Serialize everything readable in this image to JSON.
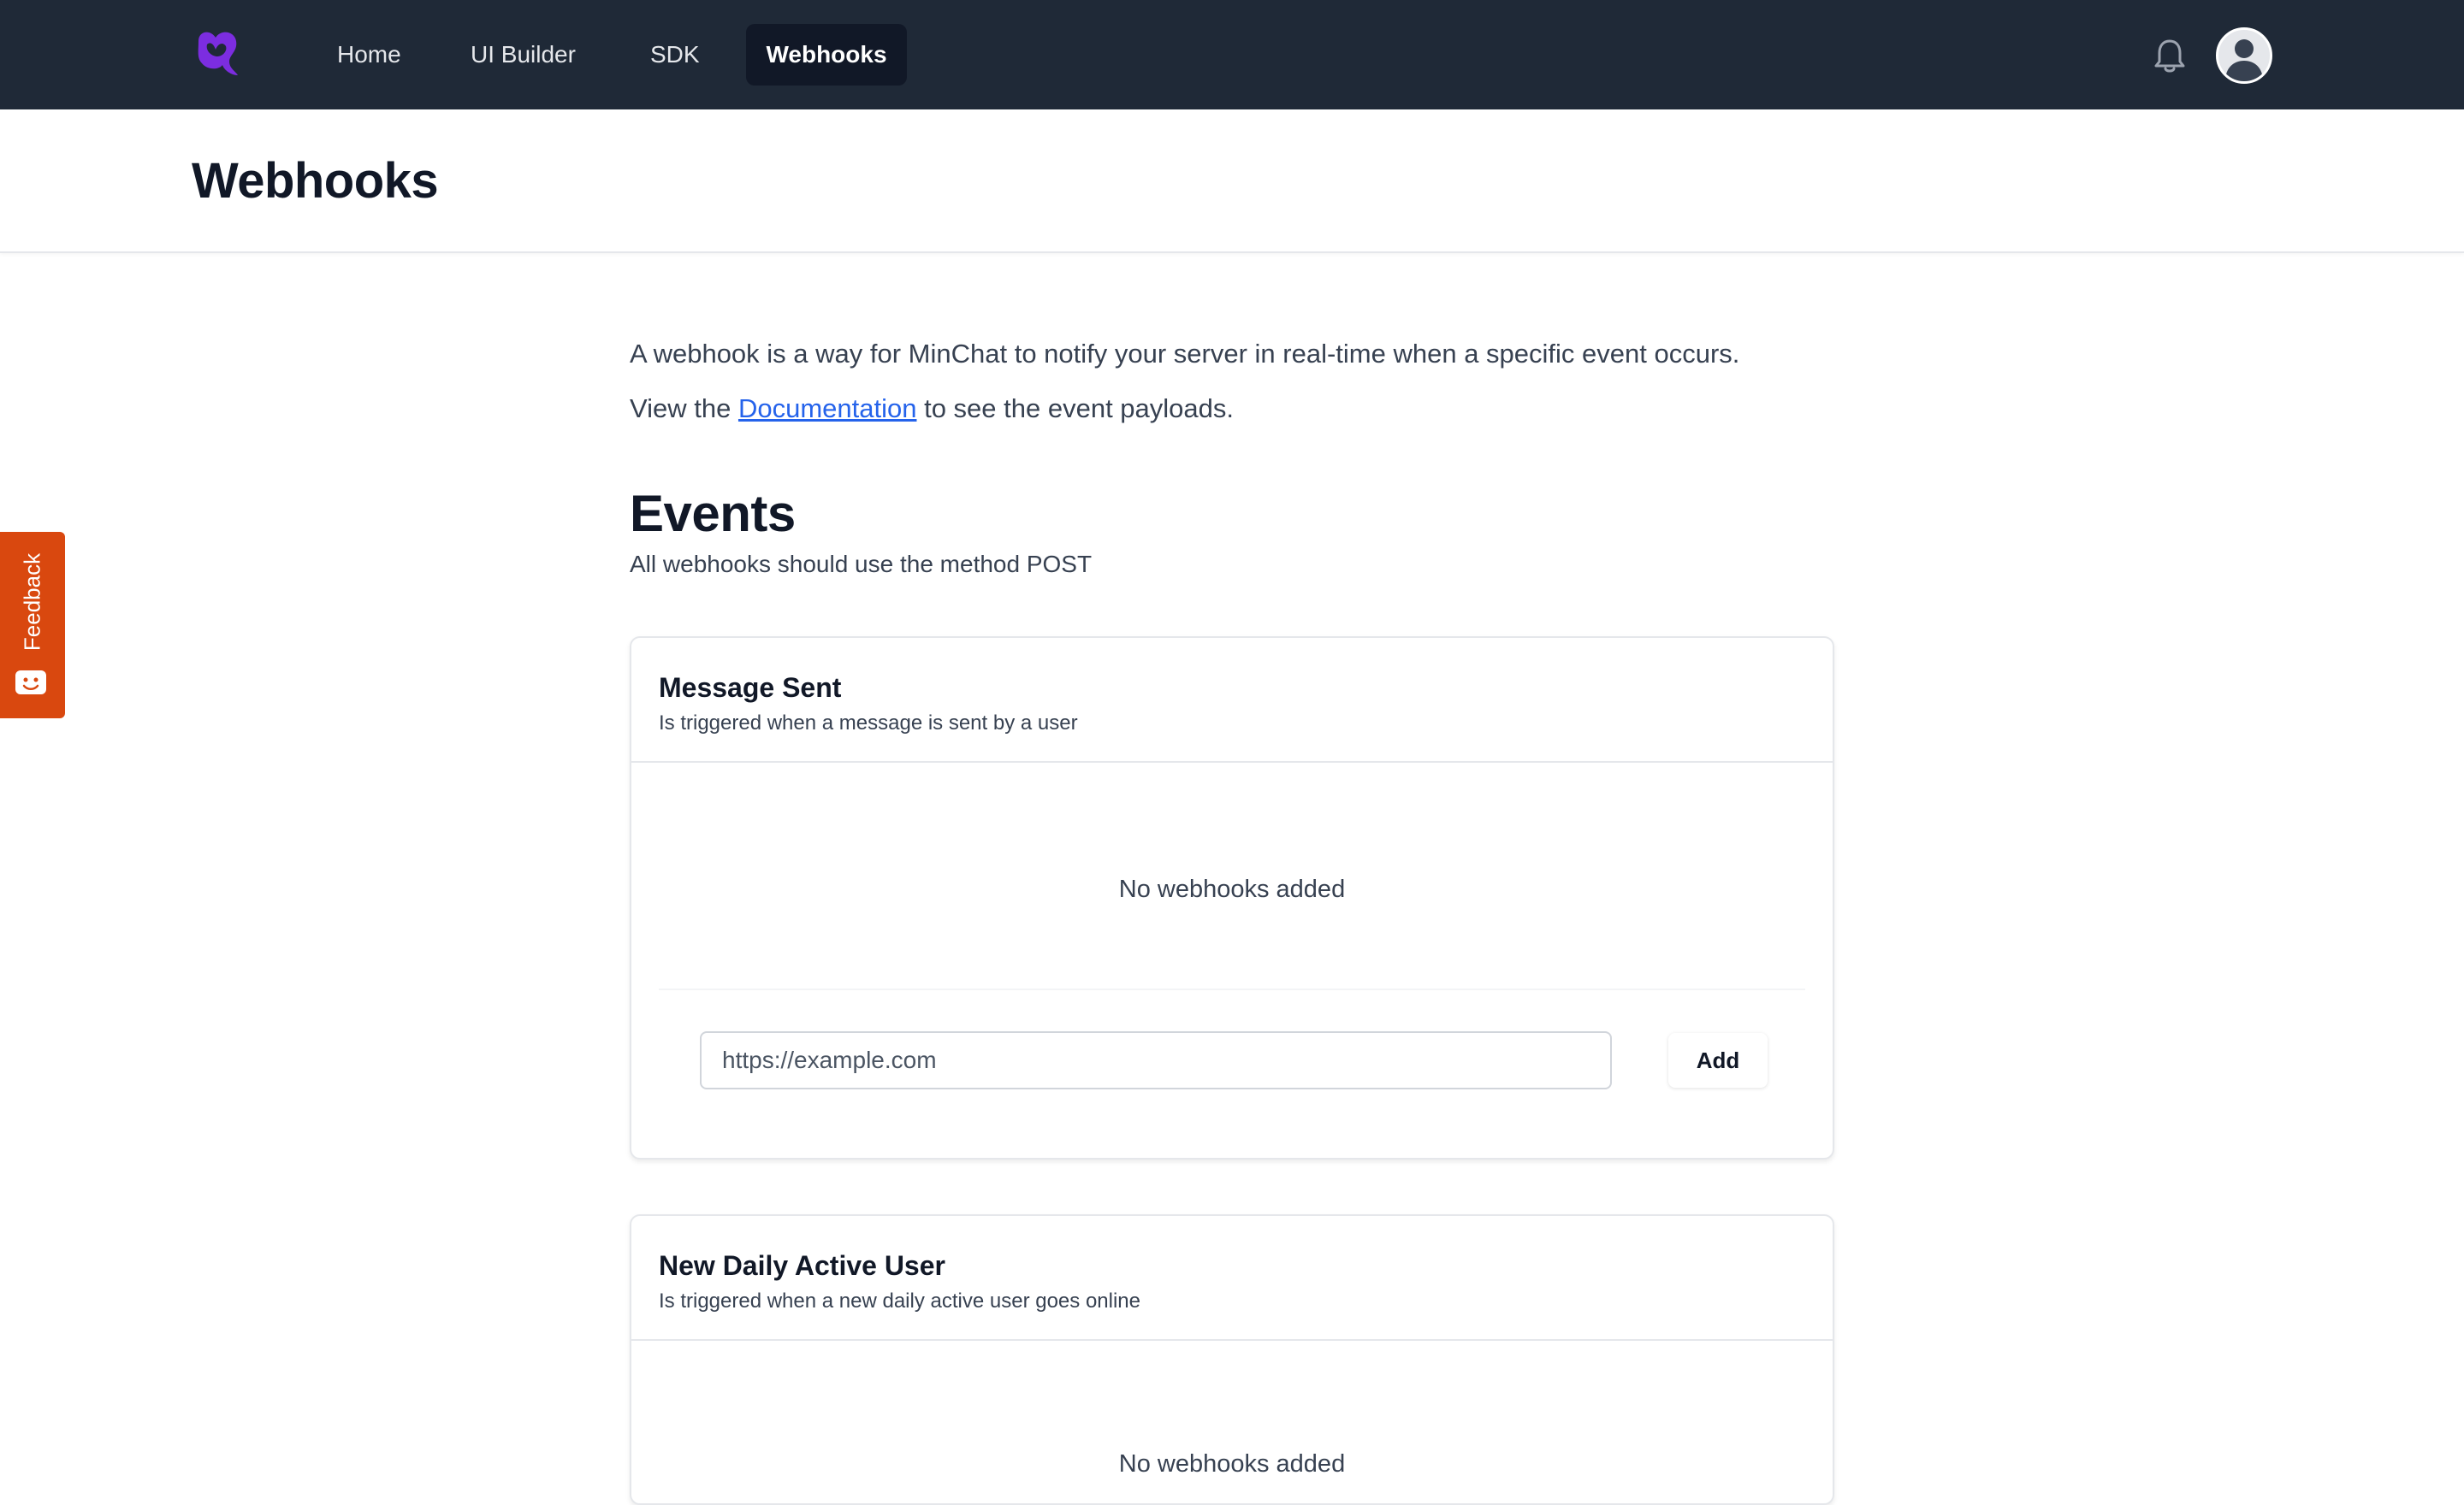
{
  "nav": {
    "logo_icon": "minchat-logo-icon",
    "items": [
      {
        "label": "Home",
        "active": false
      },
      {
        "label": "UI Builder",
        "active": false
      },
      {
        "label": "SDK",
        "active": false
      },
      {
        "label": "Webhooks",
        "active": true
      }
    ],
    "notification_icon": "bell-icon",
    "avatar_icon": "user-avatar-icon"
  },
  "page": {
    "title": "Webhooks"
  },
  "feedback": {
    "label": "Feedback",
    "color": "#d9480f"
  },
  "intro": {
    "line1": "A webhook is a way for MinChat to notify your server in real-time when a specific event occurs.",
    "line2_prefix": "View the ",
    "line2_link": "Documentation",
    "line2_suffix": " to see the event payloads."
  },
  "events": {
    "title": "Events",
    "subtitle": "All webhooks should use the method POST",
    "cards": [
      {
        "title": "Message Sent",
        "description": "Is triggered when a message is sent by a user",
        "empty_text": "No webhooks added",
        "input_placeholder": "https://example.com",
        "add_label": "Add"
      },
      {
        "title": "New Daily Active User",
        "description": "Is triggered when a new daily active user goes online",
        "empty_text": "No webhooks added"
      }
    ]
  },
  "colors": {
    "nav_bg": "#1f2937",
    "active_nav_bg": "#111827",
    "brand_purple": "#7c2de0",
    "link": "#2563eb"
  }
}
